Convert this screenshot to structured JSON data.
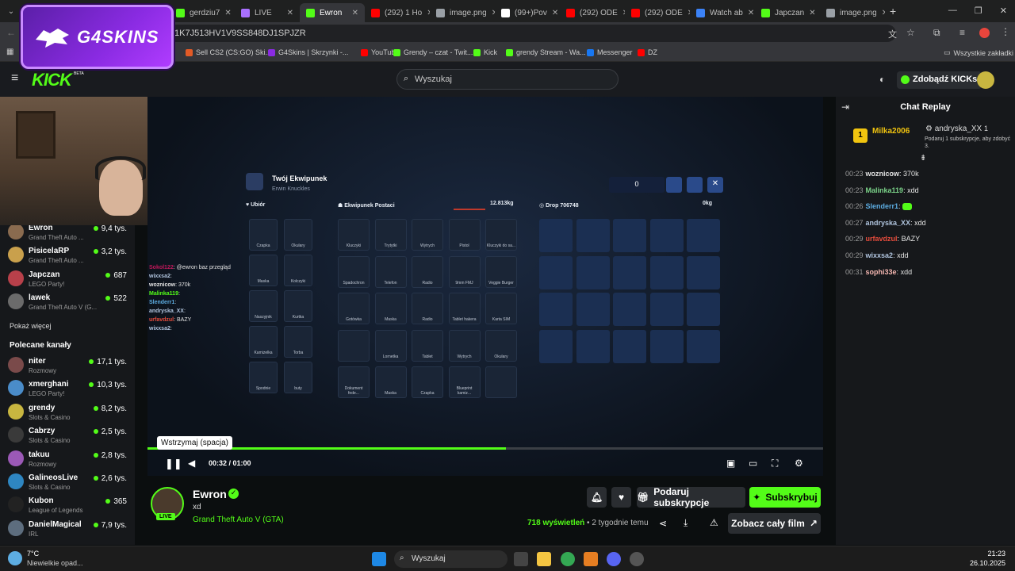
{
  "browser": {
    "tabs": [
      {
        "label": "gerdziu7",
        "color": "#53fc18"
      },
      {
        "label": "LIVE",
        "color": "#a970ff"
      },
      {
        "label": "Ewron",
        "color": "#53fc18",
        "active": true
      },
      {
        "label": "(292) 1 Ho",
        "color": "#ff0000"
      },
      {
        "label": "image.png",
        "color": "#9aa0a6"
      },
      {
        "label": "(99+)Pov",
        "color": "#ffffff"
      },
      {
        "label": "(292) ODE",
        "color": "#ff0000"
      },
      {
        "label": "(292) ODE",
        "color": "#ff0000"
      },
      {
        "label": "Watch ab",
        "color": "#3b82f6"
      },
      {
        "label": "Japczan",
        "color": "#53fc18"
      },
      {
        "label": "image.png",
        "color": "#9aa0a6"
      }
    ],
    "url": "1K7J513HV1V9SS848DJ1SPJZR",
    "bookmarks": [
      {
        "label": "Sell CS2 (CS:GO) Ski...",
        "color": "#e25a26"
      },
      {
        "label": "G4Skins | Skrzynki -...",
        "color": "#8a2be2"
      },
      {
        "label": "YouTube",
        "color": "#ff0000"
      },
      {
        "label": "Grendy – czat - Twit...",
        "color": "#53fc18"
      },
      {
        "label": "Kick",
        "color": "#53fc18"
      },
      {
        "label": "grendy Stream - Wa...",
        "color": "#53fc18"
      },
      {
        "label": "Messenger",
        "color": "#1877f2"
      },
      {
        "label": "DZ",
        "color": "#ff0000"
      }
    ],
    "bookmarks_all": "Wszystkie zakładki"
  },
  "overlay": {
    "brand": "G4SKINS"
  },
  "kick": {
    "logo": "KICK",
    "beta": "BETA",
    "search_placeholder": "Wyszukaj",
    "get_kicks": "Zdobądź KICKs"
  },
  "sidebar": {
    "following": [
      {
        "name": "Ewron",
        "game": "Grand Theft Auto ...",
        "viewers": "9,4 tys.",
        "color": "#8a6b4f"
      },
      {
        "name": "PisicelaRP",
        "game": "Grand Theft Auto ...",
        "viewers": "3,2 tys.",
        "color": "#c9a04c"
      },
      {
        "name": "Japczan",
        "game": "LEGO Party!",
        "viewers": "687",
        "color": "#b8404a"
      },
      {
        "name": "lawek",
        "game": "Grand Theft Auto V (G...",
        "viewers": "522",
        "color": "#6b6b6b"
      }
    ],
    "show_more": "Pokaż więcej",
    "recommended_title": "Polecane kanały",
    "recommended": [
      {
        "name": "niter",
        "game": "Rozmowy",
        "viewers": "17,1 tys.",
        "color": "#7a4a4a"
      },
      {
        "name": "xmerghani",
        "game": "LEGO Party!",
        "viewers": "10,3 tys.",
        "color": "#4a8cc9"
      },
      {
        "name": "grendy",
        "game": "Slots & Casino",
        "viewers": "8,2 tys.",
        "color": "#c8b640"
      },
      {
        "name": "Cabrzy",
        "game": "Slots & Casino",
        "viewers": "2,5 tys.",
        "color": "#3a3a3a"
      },
      {
        "name": "takuu",
        "game": "Rozmowy",
        "viewers": "2,8 tys.",
        "color": "#9b59b6"
      },
      {
        "name": "GalineosLive",
        "game": "Slots & Casino",
        "viewers": "2,6 tys.",
        "color": "#2e86c1"
      },
      {
        "name": "Kubon",
        "game": "League of Legends",
        "viewers": "365",
        "color": "#222222"
      },
      {
        "name": "DanielMagical",
        "game": "IRL",
        "viewers": "7,9 tys.",
        "color": "#5d6d7e"
      }
    ]
  },
  "game": {
    "inventory_title": "Twój Ekwipunek",
    "player": "Erwin Knuckles",
    "amount": "0",
    "left_title": "Ubiór",
    "mid_title": "Ekwipunek Postaci",
    "weight": "12.813kg",
    "drop_title": "Drop 706748",
    "drop_weight": "0kg",
    "outfit": [
      "Czapka",
      "Okulary",
      "Maska",
      "Kolczyki",
      "Naszyjnik",
      "Kurtka",
      "Kamizelka",
      "Torba",
      "Spodnie",
      "buty"
    ],
    "items": [
      "Kluczyki",
      "Trytytki",
      "Wytrych",
      "Pistol",
      "Kluczyki do sa...",
      "Spadochron",
      "Telefon",
      "Radio",
      "9mm FMJ",
      "Veggie Burger",
      "Gotówka",
      "Maska",
      "Radio",
      "Tablet hakera",
      "Karta SIM",
      "",
      "Lornetka",
      "Tablet",
      "Wytrych",
      "Okulary",
      "Dokument fede...",
      "Maska",
      "Czapka",
      "Blueprint kamiz...",
      ""
    ],
    "overlay_chat": [
      {
        "user": "Sokol122",
        "text": "@ewron baz przegląd",
        "color": "#c2185b"
      },
      {
        "user": "wixxsa2",
        "text": "",
        "color": "#b0c4de"
      },
      {
        "user": "woznicow",
        "text": "370k",
        "color": "#e4e4e4"
      },
      {
        "user": "Malinka119",
        "text": "",
        "color": "#53fc18"
      },
      {
        "user": "Slenderr1",
        "text": "",
        "color": "#5dade2"
      },
      {
        "user": "andryska_XX",
        "text": "",
        "color": "#b0c4de"
      },
      {
        "user": "urfavdzul",
        "text": "BAZY",
        "color": "#e74c3c"
      },
      {
        "user": "wixxsa2",
        "text": "",
        "color": "#b0c4de"
      }
    ]
  },
  "player": {
    "tooltip": "Wstrzymaj (spacja)",
    "time_current": "00:32",
    "time_total": "01:00",
    "progress": 0.53
  },
  "stream": {
    "name": "Ewron",
    "title": "xd",
    "category": "Grand Theft Auto V (GTA)",
    "live": "LIVE",
    "gift_sub": "Podaruj subskrypcje",
    "subscribe": "Subskrybuj",
    "views": "718",
    "views_label": "wyświetleń",
    "age": "2 tygodnie temu",
    "watch_full": "Zobacz cały film"
  },
  "chat": {
    "title": "Chat Replay",
    "leader_user": "Milka2006",
    "leader_rank": "1",
    "gifter_user": "andryska_XX",
    "gifter_count": "1",
    "gifter_note": "Podaruj 1 subskrypcje, aby zdobyć 3.",
    "messages": [
      {
        "time": "00:23",
        "user": "woznicow",
        "text": "370k",
        "color": "#e4e4e4"
      },
      {
        "time": "00:23",
        "user": "Malinka119",
        "text": "xdd",
        "color": "#7bd389"
      },
      {
        "time": "00:26",
        "user": "Slenderr1",
        "text": "",
        "color": "#5dade2"
      },
      {
        "time": "00:27",
        "user": "andryska_XX",
        "text": "xdd",
        "color": "#b0c4de"
      },
      {
        "time": "00:29",
        "user": "urfavdzul",
        "text": "BAZY",
        "color": "#e74c3c"
      },
      {
        "time": "00:29",
        "user": "wixxsa2",
        "text": "xdd",
        "color": "#b0c4de"
      },
      {
        "time": "00:31",
        "user": "sophi33e",
        "text": "xdd",
        "color": "#f5b7b1"
      }
    ]
  },
  "taskbar": {
    "temp": "7°C",
    "weather": "Niewielkie opad...",
    "search": "Wyszukaj",
    "time": "21:23",
    "date": "26.10.2025"
  }
}
